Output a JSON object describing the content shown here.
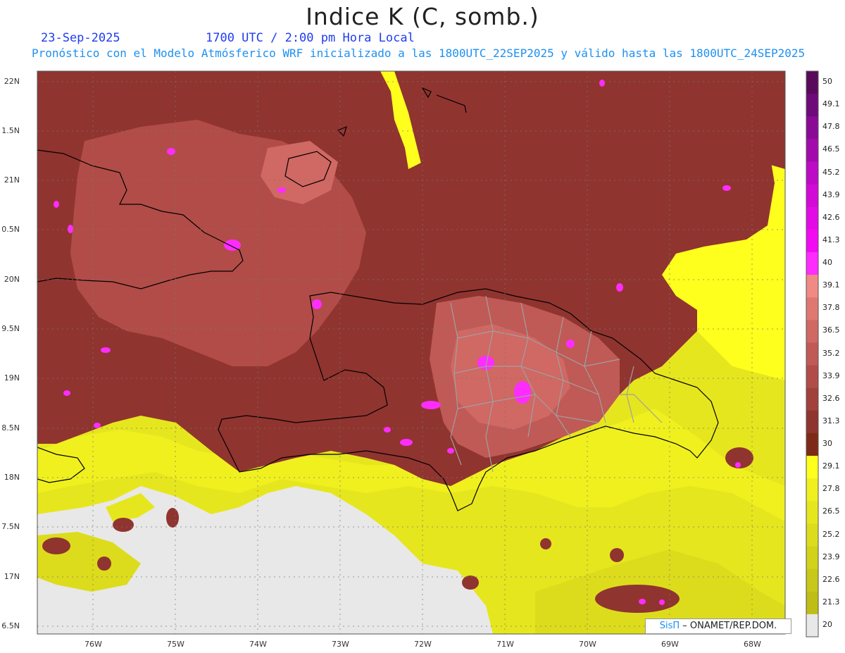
{
  "header": {
    "title": "Indice K (C, somb.)",
    "date": "23-Sep-2025",
    "time": "1700 UTC / 2:00 pm Hora Local",
    "subtitle": "Pronóstico con el Modelo Atmósferico WRF inicializado a las 1800UTC_22SEP2025 y válido hasta las  1800UTC_24SEP2025"
  },
  "map": {
    "lat_ticks": [
      "22N",
      "1.5N",
      "21N",
      "0.5N",
      "20N",
      "9.5N",
      "19N",
      "8.5N",
      "18N",
      "7.5N",
      "17N",
      "6.5N"
    ],
    "lon_ticks": [
      "76W",
      "75W",
      "74W",
      "73W",
      "72W",
      "71W",
      "70W",
      "69W",
      "68W"
    ]
  },
  "colorbar": {
    "labels": [
      "50",
      "49.1",
      "47.8",
      "46.5",
      "45.2",
      "43.9",
      "42.6",
      "41.3",
      "40",
      "39.1",
      "37.8",
      "36.5",
      "35.2",
      "33.9",
      "32.6",
      "31.3",
      "30",
      "29.1",
      "27.8",
      "26.5",
      "25.2",
      "23.9",
      "22.6",
      "21.3",
      "20"
    ],
    "colors": [
      "#5a0a5a",
      "#6e0a7a",
      "#8a0a96",
      "#a20aae",
      "#bc0ac6",
      "#d20ad8",
      "#e40ae6",
      "#f20af2",
      "#fe2cfe",
      "#f08a84",
      "#e07872",
      "#d06864",
      "#c05a56",
      "#b24c48",
      "#a2403c",
      "#903430",
      "#7e2a18",
      "#ffff1e",
      "#f0f01e",
      "#e6e61e",
      "#dcdc1c",
      "#d2d21a",
      "#c8c818",
      "#bebe16",
      "#e8e8e8"
    ]
  },
  "credit": {
    "brand": "SisΠ",
    "text": "– ONAMET/REP.DOM."
  }
}
